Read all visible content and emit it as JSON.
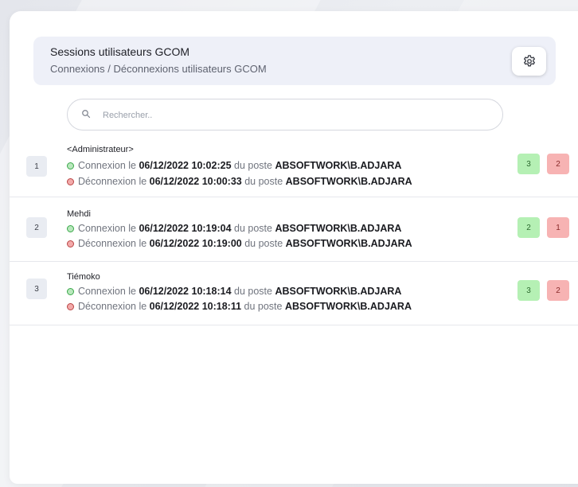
{
  "colors": {
    "connect_dot": "#3aa84a",
    "disconnect_dot": "#b94545",
    "badge_green": "#b5f0b4",
    "badge_red": "#f7b3b3",
    "header_bg": "#eef0f8"
  },
  "header": {
    "title": "Sessions utilisateurs GCOM",
    "subtitle": "Connexions / Déconnexions utilisateurs GCOM",
    "settings_icon": "gear-icon"
  },
  "search": {
    "placeholder": "Rechercher..",
    "value": "",
    "icon": "search-icon"
  },
  "labels": {
    "connexion_prefix": "Connexion le ",
    "deconnexion_prefix": "Déconnexion le ",
    "poste": " du poste "
  },
  "sessions": [
    {
      "index": "1",
      "user": "<Administrateur>",
      "connexion_date": "06/12/2022 10:02:25",
      "connexion_poste": "ABSOFTWORK\\B.ADJARA",
      "deconnexion_date": "06/12/2022 10:00:33",
      "deconnexion_poste": "ABSOFTWORK\\B.ADJARA",
      "connexions_count": "3",
      "deconnexions_count": "2"
    },
    {
      "index": "2",
      "user": "Mehdi",
      "connexion_date": "06/12/2022 10:19:04",
      "connexion_poste": "ABSOFTWORK\\B.ADJARA",
      "deconnexion_date": "06/12/2022 10:19:00",
      "deconnexion_poste": "ABSOFTWORK\\B.ADJARA",
      "connexions_count": "2",
      "deconnexions_count": "1"
    },
    {
      "index": "3",
      "user": "Tiémoko",
      "connexion_date": "06/12/2022 10:18:14",
      "connexion_poste": "ABSOFTWORK\\B.ADJARA",
      "deconnexion_date": "06/12/2022 10:18:11",
      "deconnexion_poste": "ABSOFTWORK\\B.ADJARA",
      "connexions_count": "3",
      "deconnexions_count": "2"
    }
  ]
}
